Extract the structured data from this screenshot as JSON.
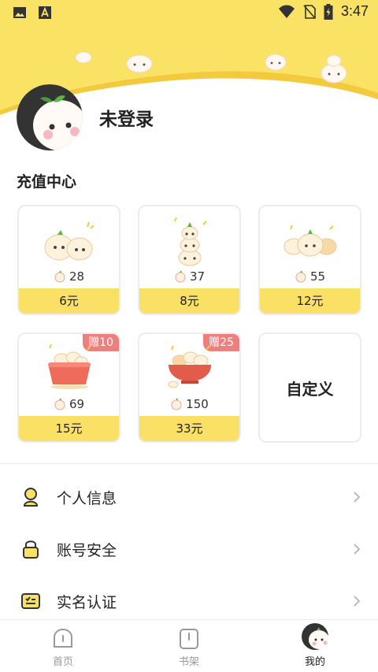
{
  "status_bar": {
    "time": "3:47"
  },
  "profile": {
    "login_status": "未登录"
  },
  "recharge": {
    "title": "充值中心",
    "packages": [
      {
        "coins": "28",
        "price": "6元",
        "bonus": ""
      },
      {
        "coins": "37",
        "price": "8元",
        "bonus": ""
      },
      {
        "coins": "55",
        "price": "12元",
        "bonus": ""
      },
      {
        "coins": "69",
        "price": "15元",
        "bonus": "赠10"
      },
      {
        "coins": "150",
        "price": "33元",
        "bonus": "赠25"
      }
    ],
    "custom_label": "自定义"
  },
  "menu": [
    {
      "label": "个人信息",
      "icon": "person-icon"
    },
    {
      "label": "账号安全",
      "icon": "lock-icon"
    },
    {
      "label": "实名认证",
      "icon": "id-card-icon"
    }
  ],
  "bottom_nav": [
    {
      "label": "首页",
      "icon": "home-icon",
      "active": false
    },
    {
      "label": "书架",
      "icon": "bookshelf-icon",
      "active": false
    },
    {
      "label": "我的",
      "icon": "profile-avatar-icon",
      "active": true
    }
  ],
  "colors": {
    "accent": "#fae064",
    "bonus": "#ef7e7e",
    "header": "#f9e264"
  }
}
